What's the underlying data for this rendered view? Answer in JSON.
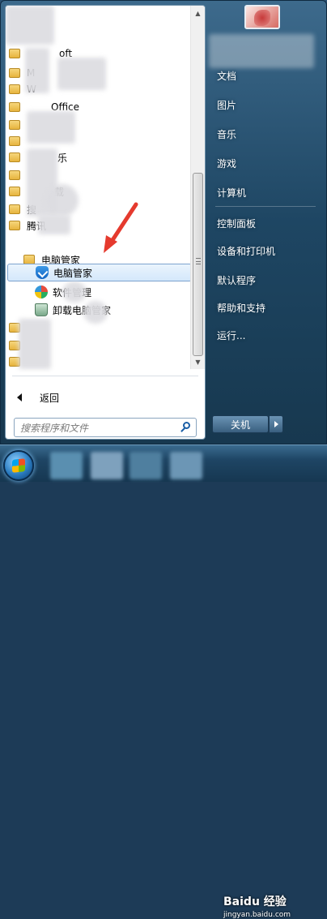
{
  "left_pane": {
    "programs": [
      {
        "label": "oft",
        "type": "folder"
      },
      {
        "label": "M",
        "type": "folder"
      },
      {
        "label": "W",
        "type": "folder"
      },
      {
        "label": "Office",
        "type": "folder"
      },
      {
        "label": "",
        "type": "folder"
      },
      {
        "label": "",
        "type": "folder"
      },
      {
        "label": "乐",
        "type": "folder"
      },
      {
        "label": "",
        "type": "folder"
      },
      {
        "label": "载",
        "type": "folder"
      },
      {
        "label": "搜",
        "type": "folder"
      },
      {
        "label": "腾讯",
        "type": "folder"
      }
    ],
    "subfolder": {
      "label": "电脑管家",
      "type": "folder"
    },
    "subitems": [
      {
        "label": "电脑管家",
        "icon": "shield-check-icon",
        "selected": true
      },
      {
        "label": "软件管理",
        "icon": "pinwheel-icon",
        "selected": false
      },
      {
        "label": "卸载电脑管家",
        "icon": "recycle-bin-icon",
        "selected": false
      }
    ],
    "back_label": "返回",
    "search_placeholder": "搜索程序和文件"
  },
  "right_pane": {
    "items": [
      "文档",
      "图片",
      "音乐",
      "游戏",
      "计算机",
      "控制面板",
      "设备和打印机",
      "默认程序",
      "帮助和支持",
      "运行..."
    ],
    "shutdown_label": "关机"
  },
  "watermark": {
    "main": "Baidu 经验",
    "sub": "jingyan.baidu.com"
  }
}
